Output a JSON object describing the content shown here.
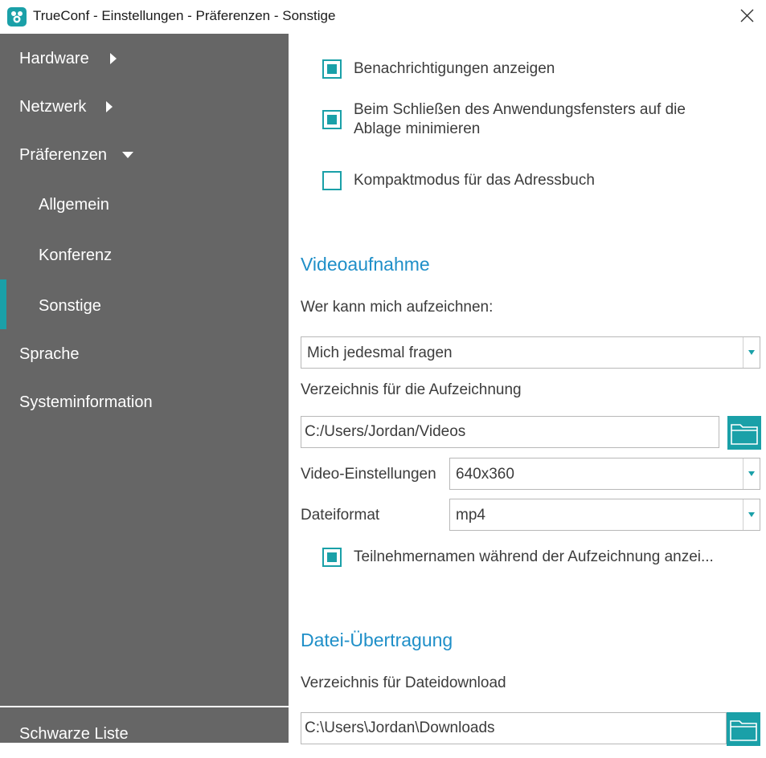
{
  "window": {
    "title": "TrueConf - Einstellungen - Präferenzen - Sonstige"
  },
  "sidebar": {
    "items": [
      {
        "label": "Hardware",
        "arrow": "right"
      },
      {
        "label": "Netzwerk",
        "arrow": "right"
      },
      {
        "label": "Präferenzen",
        "arrow": "down"
      },
      {
        "label": "Allgemein"
      },
      {
        "label": "Konferenz"
      },
      {
        "label": "Sonstige",
        "active": true
      },
      {
        "label": "Sprache"
      },
      {
        "label": "Systeminformation"
      }
    ],
    "bottom_item": "Schwarze Liste"
  },
  "general": {
    "notifications": {
      "label": "Benachrichtigungen anzeigen",
      "checked": true
    },
    "minimize_tray": {
      "label_line1": "Beim Schließen des Anwendungsfensters auf die",
      "label_line2": "Ablage minimieren",
      "checked": true
    },
    "compact_mode": {
      "label": "Kompaktmodus für das Adressbuch",
      "checked": false
    }
  },
  "video_recording": {
    "title": "Videoaufnahme",
    "who_can_record_label": "Wer kann mich aufzeichnen:",
    "who_can_record_value": "Mich jedesmal fragen",
    "directory_label": "Verzeichnis für die Aufzeichnung",
    "directory_value": "C:/Users/Jordan/Videos",
    "video_settings_label": "Video-Einstellungen",
    "video_settings_value": "640x360",
    "file_format_label": "Dateiformat",
    "file_format_value": "mp4",
    "show_names": {
      "label": "Teilnehmernamen während der Aufzeichnung anzei...",
      "checked": true
    }
  },
  "file_transfer": {
    "title": "Datei-Übertragung",
    "download_dir_label": "Verzeichnis für Dateidownload",
    "download_dir_value": "C:\\Users\\Jordan\\Downloads"
  },
  "colors": {
    "accent": "#1aa0a8",
    "sidebar_bg": "#666666",
    "section_title": "#1f8fc8"
  },
  "icons": {
    "app": "trueconf-logo-icon",
    "close": "close-icon",
    "folder": "folder-icon",
    "dropdown": "triangle-down-icon"
  }
}
